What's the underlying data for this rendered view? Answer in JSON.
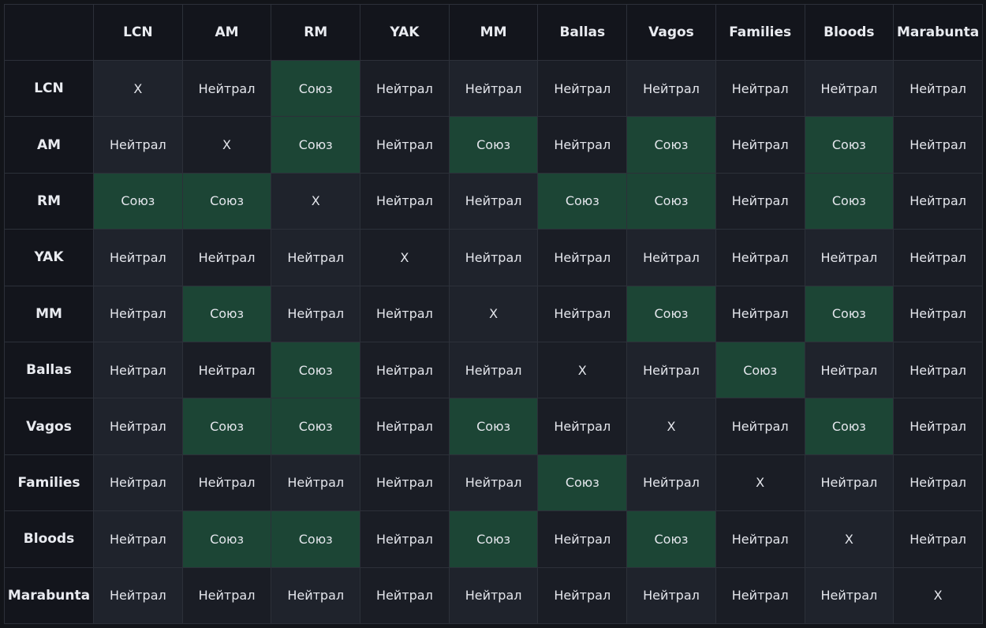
{
  "factions": [
    "LCN",
    "AM",
    "RM",
    "YAK",
    "MM",
    "Ballas",
    "Vagos",
    "Families",
    "Bloods",
    "Marabunta"
  ],
  "self_label": "X",
  "neutral_label": "Нейтрал",
  "ally_label": "Союз",
  "colors": {
    "page_background": "#121419",
    "header_background": "#13151c",
    "ally_cell": "#1c4535",
    "neutral_cell": "#1f232c",
    "grid_line": "#2c3039"
  },
  "matrix": [
    [
      "X",
      "Нейтрал",
      "Союз",
      "Нейтрал",
      "Нейтрал",
      "Нейтрал",
      "Нейтрал",
      "Нейтрал",
      "Нейтрал",
      "Нейтрал"
    ],
    [
      "Нейтрал",
      "X",
      "Союз",
      "Нейтрал",
      "Союз",
      "Нейтрал",
      "Союз",
      "Нейтрал",
      "Союз",
      "Нейтрал"
    ],
    [
      "Союз",
      "Союз",
      "X",
      "Нейтрал",
      "Нейтрал",
      "Союз",
      "Союз",
      "Нейтрал",
      "Союз",
      "Нейтрал"
    ],
    [
      "Нейтрал",
      "Нейтрал",
      "Нейтрал",
      "X",
      "Нейтрал",
      "Нейтрал",
      "Нейтрал",
      "Нейтрал",
      "Нейтрал",
      "Нейтрал"
    ],
    [
      "Нейтрал",
      "Союз",
      "Нейтрал",
      "Нейтрал",
      "X",
      "Нейтрал",
      "Союз",
      "Нейтрал",
      "Союз",
      "Нейтрал"
    ],
    [
      "Нейтрал",
      "Нейтрал",
      "Союз",
      "Нейтрал",
      "Нейтрал",
      "X",
      "Нейтрал",
      "Союз",
      "Нейтрал",
      "Нейтрал"
    ],
    [
      "Нейтрал",
      "Союз",
      "Союз",
      "Нейтрал",
      "Союз",
      "Нейтрал",
      "X",
      "Нейтрал",
      "Союз",
      "Нейтрал"
    ],
    [
      "Нейтрал",
      "Нейтрал",
      "Нейтрал",
      "Нейтрал",
      "Нейтрал",
      "Союз",
      "Нейтрал",
      "X",
      "Нейтрал",
      "Нейтрал"
    ],
    [
      "Нейтрал",
      "Союз",
      "Союз",
      "Нейтрал",
      "Союз",
      "Нейтрал",
      "Союз",
      "Нейтрал",
      "X",
      "Нейтрал"
    ],
    [
      "Нейтрал",
      "Нейтрал",
      "Нейтрал",
      "Нейтрал",
      "Нейтрал",
      "Нейтрал",
      "Нейтрал",
      "Нейтрал",
      "Нейтрал",
      "X"
    ]
  ]
}
